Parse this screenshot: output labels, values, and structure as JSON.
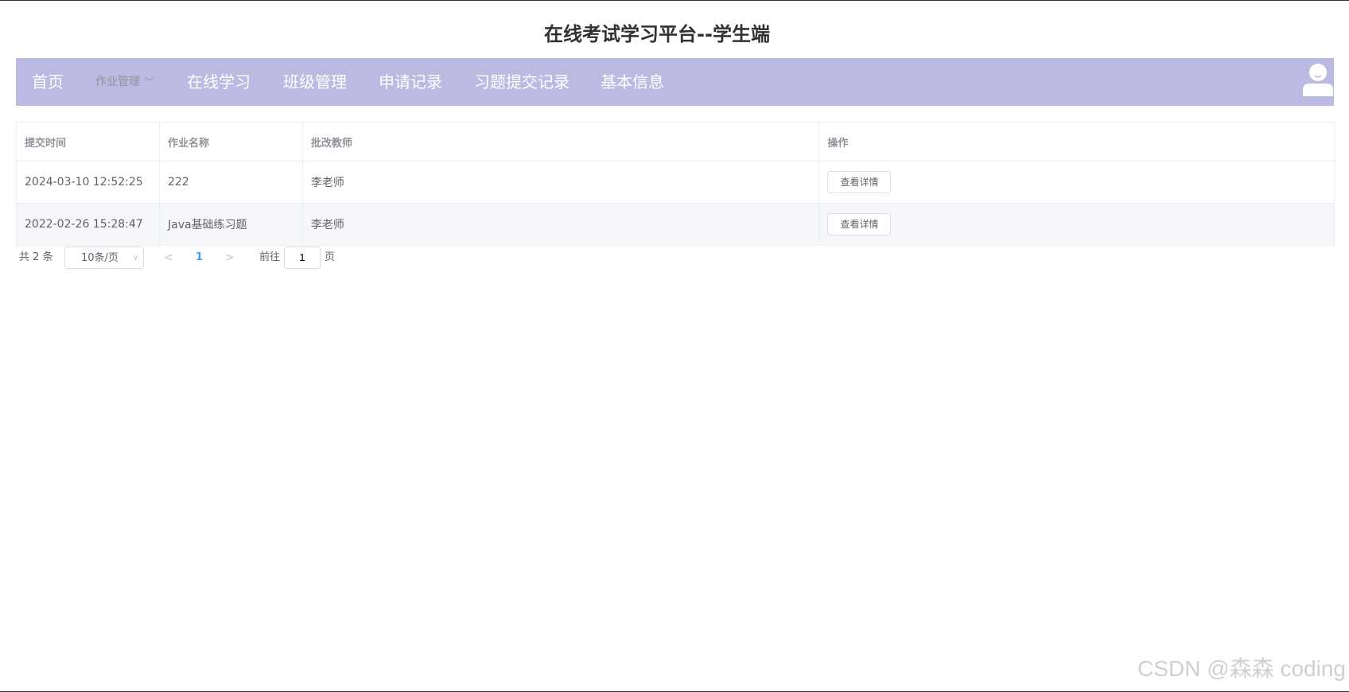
{
  "header": {
    "title": "在线考试学习平台--学生端"
  },
  "nav": {
    "home": "首页",
    "homework": "作业管理",
    "online_study": "在线学习",
    "class_mgmt": "班级管理",
    "apply_records": "申请记录",
    "submit_records": "习题提交记录",
    "basic_info": "基本信息",
    "bg_color": "#bbbae3"
  },
  "table": {
    "columns": [
      "提交时间",
      "作业名称",
      "批改教师",
      "操作"
    ],
    "rows": [
      {
        "time": "2024-03-10 12:52:25",
        "name": "222",
        "teacher": "李老师",
        "action": "查看详情"
      },
      {
        "time": "2022-02-26 15:28:47",
        "name": "Java基础练习题",
        "teacher": "李老师",
        "action": "查看详情"
      }
    ]
  },
  "pagination": {
    "total": "共 2 条",
    "page_size": "10条/页",
    "current_page": "1",
    "goto_prefix": "前往",
    "goto_value": "1",
    "goto_suffix": "页"
  },
  "watermark": "CSDN @森森 coding"
}
